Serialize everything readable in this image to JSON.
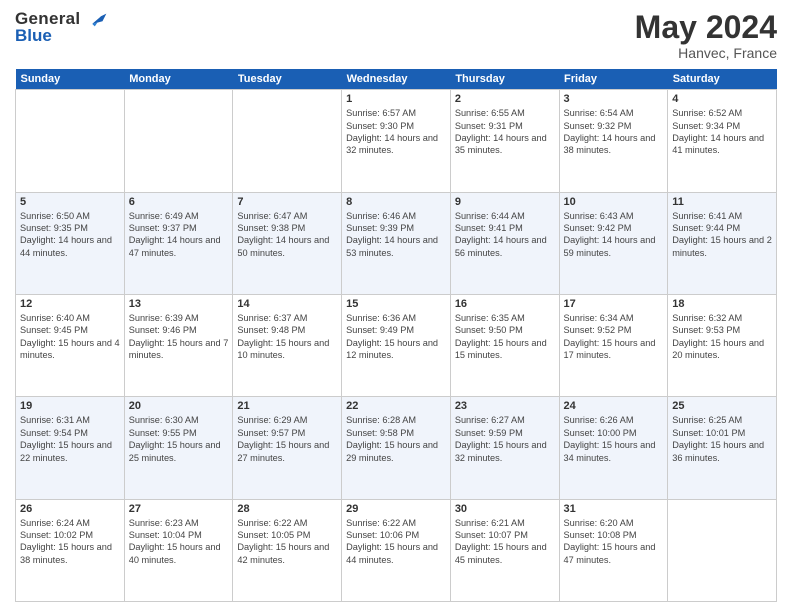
{
  "header": {
    "logo_line1": "General",
    "logo_line2": "Blue",
    "month": "May 2024",
    "location": "Hanvec, France"
  },
  "weekdays": [
    "Sunday",
    "Monday",
    "Tuesday",
    "Wednesday",
    "Thursday",
    "Friday",
    "Saturday"
  ],
  "weeks": [
    [
      null,
      null,
      null,
      {
        "day": "1",
        "sunrise": "6:57 AM",
        "sunset": "9:30 PM",
        "daylight": "14 hours and 32 minutes."
      },
      {
        "day": "2",
        "sunrise": "6:55 AM",
        "sunset": "9:31 PM",
        "daylight": "14 hours and 35 minutes."
      },
      {
        "day": "3",
        "sunrise": "6:54 AM",
        "sunset": "9:32 PM",
        "daylight": "14 hours and 38 minutes."
      },
      {
        "day": "4",
        "sunrise": "6:52 AM",
        "sunset": "9:34 PM",
        "daylight": "14 hours and 41 minutes."
      }
    ],
    [
      {
        "day": "5",
        "sunrise": "6:50 AM",
        "sunset": "9:35 PM",
        "daylight": "14 hours and 44 minutes."
      },
      {
        "day": "6",
        "sunrise": "6:49 AM",
        "sunset": "9:37 PM",
        "daylight": "14 hours and 47 minutes."
      },
      {
        "day": "7",
        "sunrise": "6:47 AM",
        "sunset": "9:38 PM",
        "daylight": "14 hours and 50 minutes."
      },
      {
        "day": "8",
        "sunrise": "6:46 AM",
        "sunset": "9:39 PM",
        "daylight": "14 hours and 53 minutes."
      },
      {
        "day": "9",
        "sunrise": "6:44 AM",
        "sunset": "9:41 PM",
        "daylight": "14 hours and 56 minutes."
      },
      {
        "day": "10",
        "sunrise": "6:43 AM",
        "sunset": "9:42 PM",
        "daylight": "14 hours and 59 minutes."
      },
      {
        "day": "11",
        "sunrise": "6:41 AM",
        "sunset": "9:44 PM",
        "daylight": "15 hours and 2 minutes."
      }
    ],
    [
      {
        "day": "12",
        "sunrise": "6:40 AM",
        "sunset": "9:45 PM",
        "daylight": "15 hours and 4 minutes."
      },
      {
        "day": "13",
        "sunrise": "6:39 AM",
        "sunset": "9:46 PM",
        "daylight": "15 hours and 7 minutes."
      },
      {
        "day": "14",
        "sunrise": "6:37 AM",
        "sunset": "9:48 PM",
        "daylight": "15 hours and 10 minutes."
      },
      {
        "day": "15",
        "sunrise": "6:36 AM",
        "sunset": "9:49 PM",
        "daylight": "15 hours and 12 minutes."
      },
      {
        "day": "16",
        "sunrise": "6:35 AM",
        "sunset": "9:50 PM",
        "daylight": "15 hours and 15 minutes."
      },
      {
        "day": "17",
        "sunrise": "6:34 AM",
        "sunset": "9:52 PM",
        "daylight": "15 hours and 17 minutes."
      },
      {
        "day": "18",
        "sunrise": "6:32 AM",
        "sunset": "9:53 PM",
        "daylight": "15 hours and 20 minutes."
      }
    ],
    [
      {
        "day": "19",
        "sunrise": "6:31 AM",
        "sunset": "9:54 PM",
        "daylight": "15 hours and 22 minutes."
      },
      {
        "day": "20",
        "sunrise": "6:30 AM",
        "sunset": "9:55 PM",
        "daylight": "15 hours and 25 minutes."
      },
      {
        "day": "21",
        "sunrise": "6:29 AM",
        "sunset": "9:57 PM",
        "daylight": "15 hours and 27 minutes."
      },
      {
        "day": "22",
        "sunrise": "6:28 AM",
        "sunset": "9:58 PM",
        "daylight": "15 hours and 29 minutes."
      },
      {
        "day": "23",
        "sunrise": "6:27 AM",
        "sunset": "9:59 PM",
        "daylight": "15 hours and 32 minutes."
      },
      {
        "day": "24",
        "sunrise": "6:26 AM",
        "sunset": "10:00 PM",
        "daylight": "15 hours and 34 minutes."
      },
      {
        "day": "25",
        "sunrise": "6:25 AM",
        "sunset": "10:01 PM",
        "daylight": "15 hours and 36 minutes."
      }
    ],
    [
      {
        "day": "26",
        "sunrise": "6:24 AM",
        "sunset": "10:02 PM",
        "daylight": "15 hours and 38 minutes."
      },
      {
        "day": "27",
        "sunrise": "6:23 AM",
        "sunset": "10:04 PM",
        "daylight": "15 hours and 40 minutes."
      },
      {
        "day": "28",
        "sunrise": "6:22 AM",
        "sunset": "10:05 PM",
        "daylight": "15 hours and 42 minutes."
      },
      {
        "day": "29",
        "sunrise": "6:22 AM",
        "sunset": "10:06 PM",
        "daylight": "15 hours and 44 minutes."
      },
      {
        "day": "30",
        "sunrise": "6:21 AM",
        "sunset": "10:07 PM",
        "daylight": "15 hours and 45 minutes."
      },
      {
        "day": "31",
        "sunrise": "6:20 AM",
        "sunset": "10:08 PM",
        "daylight": "15 hours and 47 minutes."
      },
      null
    ]
  ]
}
